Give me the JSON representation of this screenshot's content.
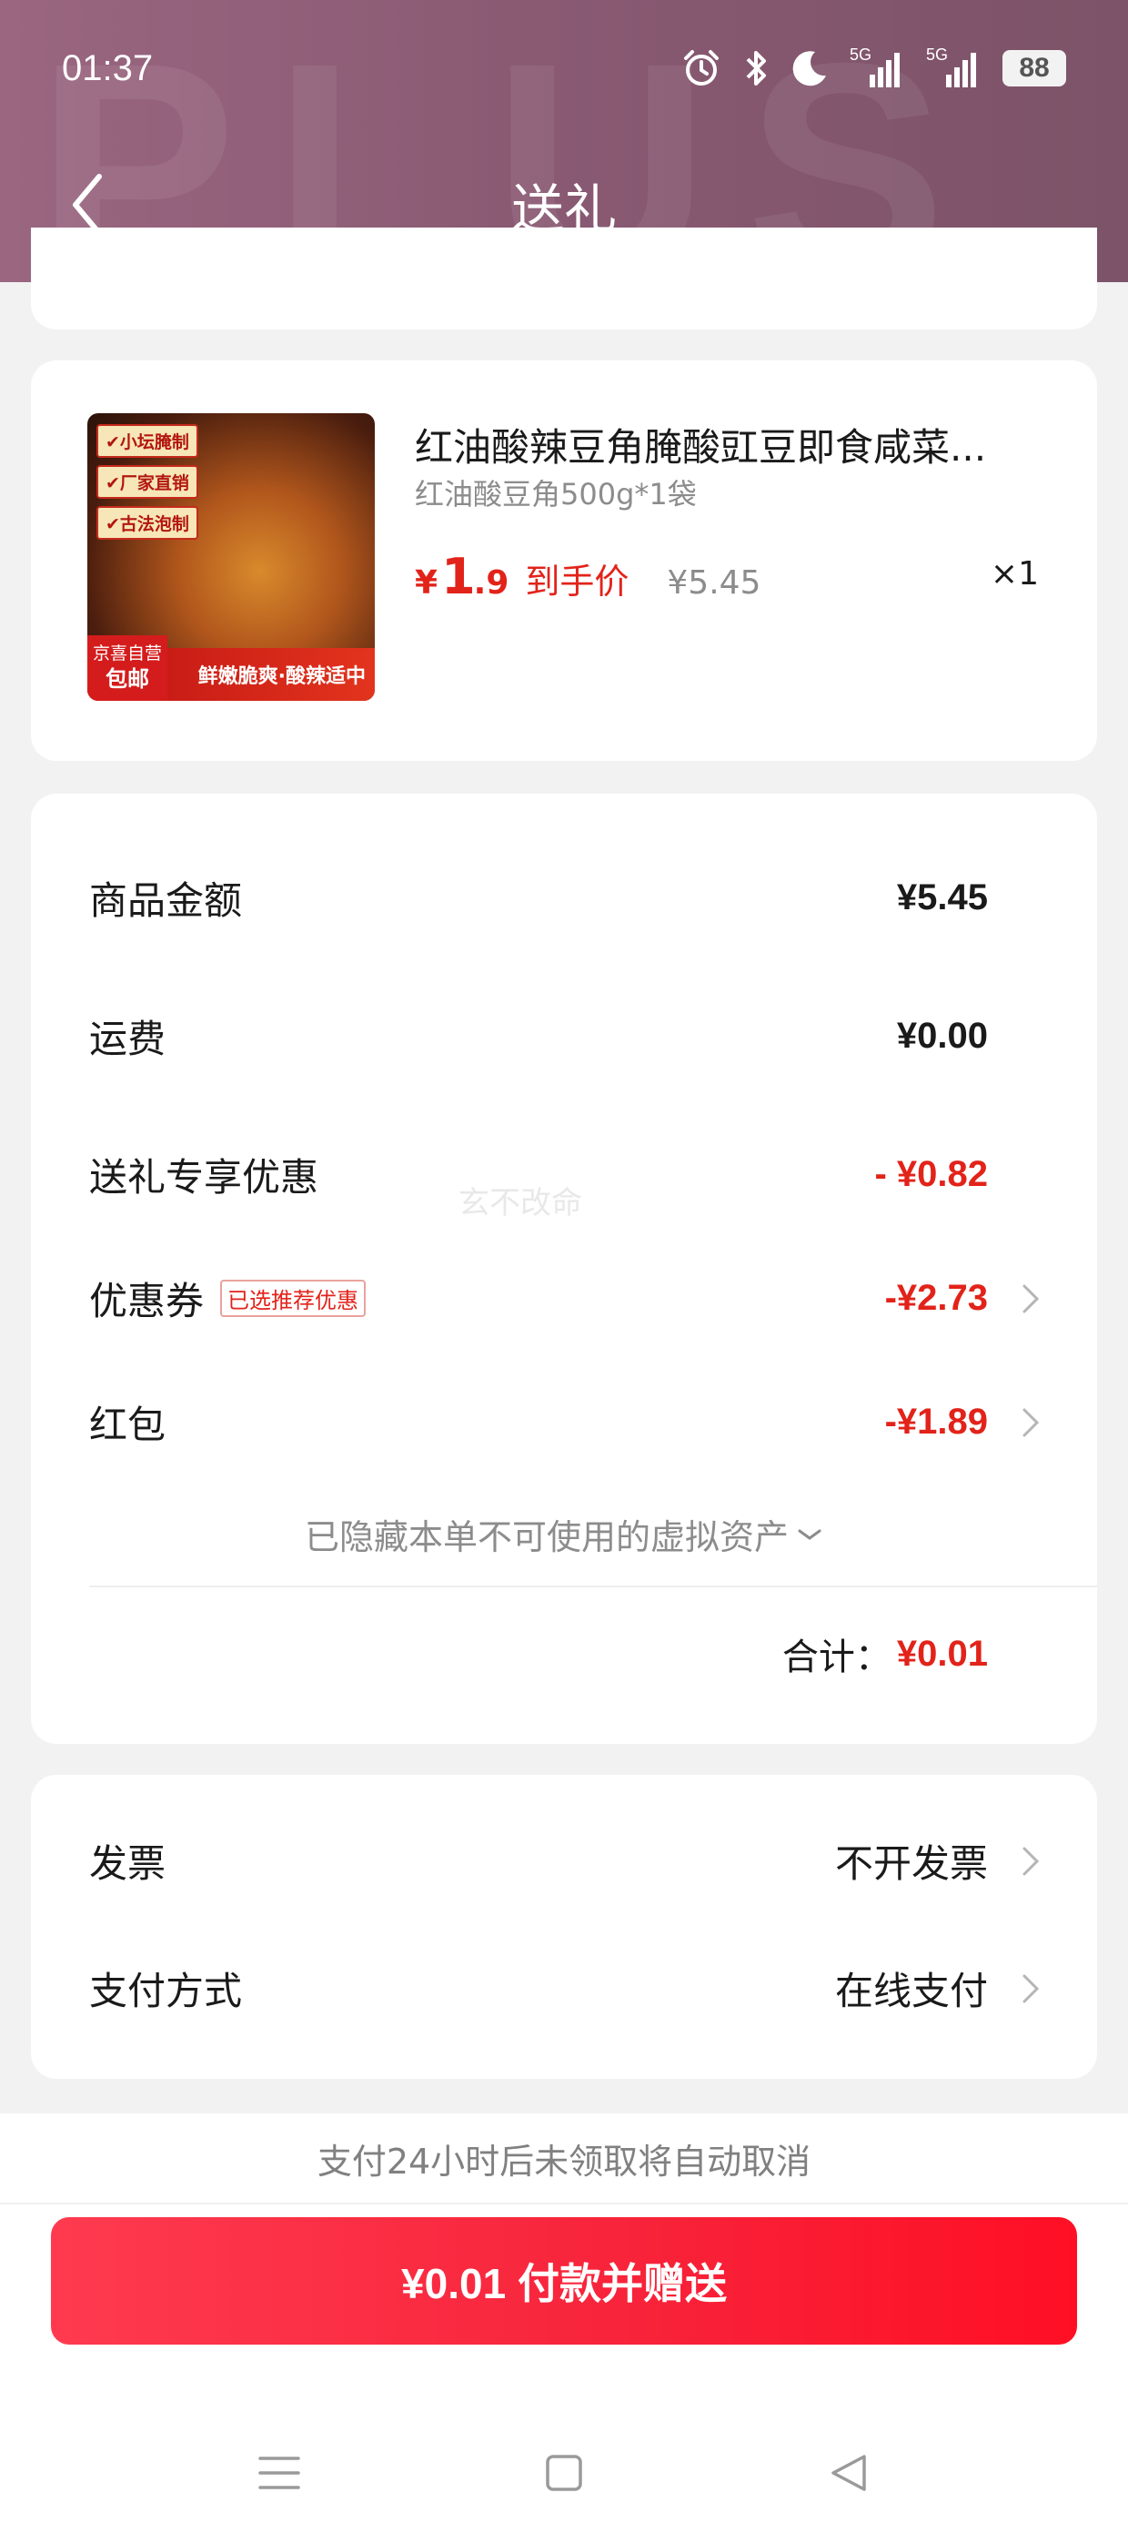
{
  "status_bar": {
    "time": "01:37",
    "icons": [
      "alarm-icon",
      "bluetooth-icon",
      "moon-icon",
      "signal-5g-icon",
      "signal-5g-icon"
    ],
    "network_label": "5G",
    "battery": "88"
  },
  "header": {
    "title": "送礼",
    "watermark": "PLUS",
    "back_icon": "chevron-left-icon"
  },
  "product": {
    "thumb_tags": [
      "✔小坛腌制",
      "✔厂家直销",
      "✔古法泡制"
    ],
    "thumb_banner": "鲜嫩脆爽·酸辣适中",
    "thumb_badge_top": "京喜自营",
    "thumb_badge_bottom": "包邮",
    "title": "红油酸辣豆角腌酸豇豆即食咸菜...",
    "spec": "红油酸豆角500g*1袋",
    "price_symbol": "¥",
    "price_int": "1",
    "price_dec": ".9",
    "price_label": "到手价",
    "original_price": "¥5.45",
    "quantity": "×1"
  },
  "amounts": {
    "goods_label": "商品金额",
    "goods_value": "¥5.45",
    "shipping_label": "运费",
    "shipping_value": "¥0.00",
    "gift_discount_label": "送礼专享优惠",
    "gift_discount_value": "- ¥0.82",
    "coupon_label": "优惠券",
    "coupon_tag": "已选推荐优惠",
    "coupon_value": "-¥2.73",
    "redpacket_label": "红包",
    "redpacket_value": "-¥1.89",
    "hidden_assets": "已隐藏本单不可使用的虚拟资产",
    "total_label": "合计：",
    "total_value": "¥0.01",
    "watermark": "玄不改命"
  },
  "payment": {
    "invoice_label": "发票",
    "invoice_value": "不开发票",
    "method_label": "支付方式",
    "method_value": "在线支付"
  },
  "footer": {
    "notice": "支付24小时后未领取将自动取消",
    "pay_button": "¥0.01 付款并赠送"
  },
  "system_nav": [
    "menu-icon",
    "home-square-icon",
    "back-triangle-icon"
  ],
  "colors": {
    "accent_red": "#e2231a",
    "header_bg": "#8a5a73",
    "pay_button": "#f7243b"
  }
}
